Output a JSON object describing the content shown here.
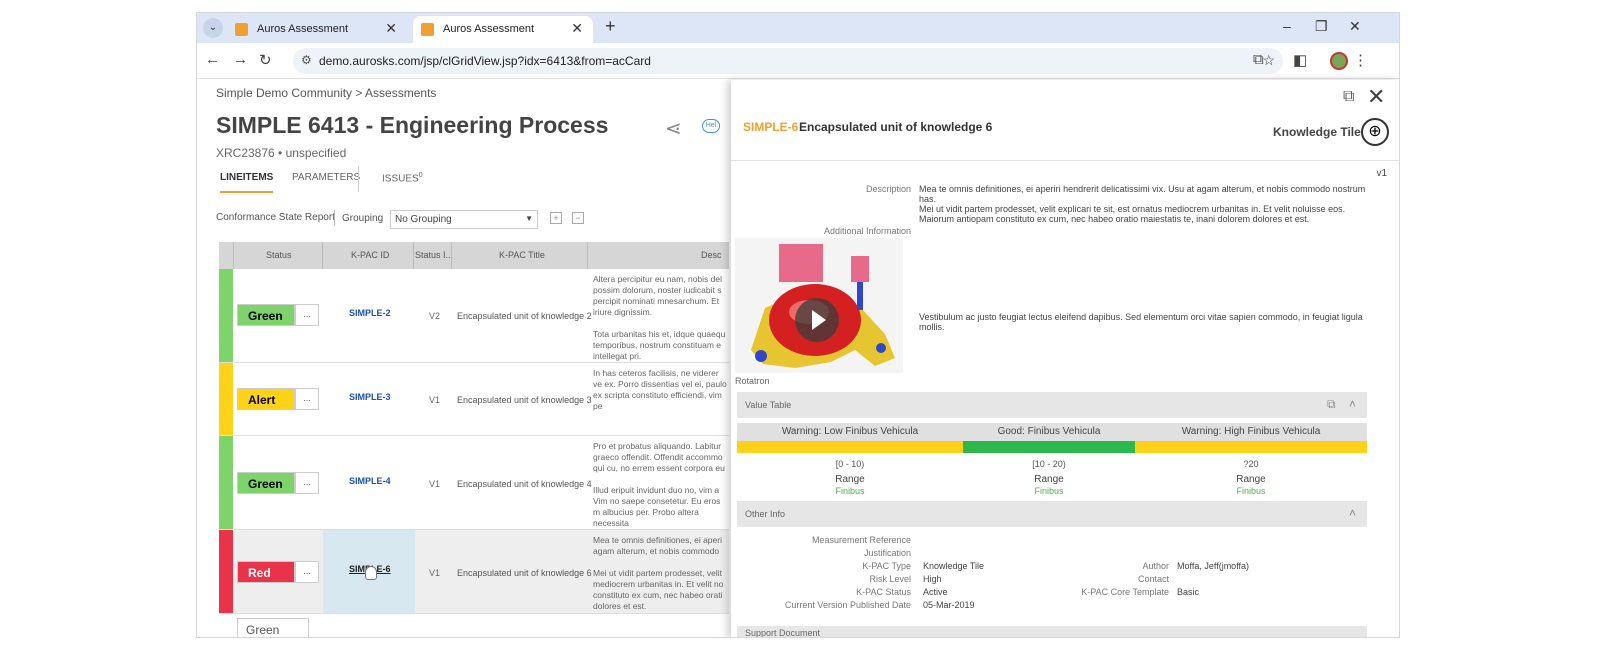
{
  "browser": {
    "tabs": [
      {
        "title": "Auros Assessment",
        "active": false
      },
      {
        "title": "Auros Assessment",
        "active": true
      }
    ],
    "new_tab": "+",
    "url": "demo.aurosks.com/jsp/clGridView.jsp?idx=6413&from=acCard",
    "controls": {
      "minimize": "–",
      "restore": "❐",
      "close": "✕"
    }
  },
  "page": {
    "breadcrumb": "Simple Demo Community > Assessments",
    "title": "SIMPLE 6413 - Engineering Process",
    "subtitle": "XRC23876 • unspecified",
    "help_label": "Hel",
    "tabs": [
      {
        "label": "LINEITEMS",
        "active": true
      },
      {
        "label": "PARAMETERS",
        "active": false
      },
      {
        "label": "ISSUES",
        "active": false,
        "count": "0"
      }
    ],
    "toolbar": {
      "report_label": "Conformance State Report",
      "grouping_label": "Grouping",
      "grouping_value": "No Grouping",
      "expand": "+",
      "collapse": "−"
    },
    "grid": {
      "columns": [
        "Status",
        "K-PAC ID",
        "Status I...",
        "K-PAC Title",
        "Desc"
      ],
      "rows": [
        {
          "status": "Green",
          "status_color": "#7ed36b",
          "bar_color": "#7ed36b",
          "id": "SIMPLE-2",
          "version": "V2",
          "title": "Encapsulated unit of knowledge 2",
          "desc": "Altera percipitur eu nam, nobis del possim dolorum, noster iudicabit s percipit nominati mnesarchum. Et iriure dignissim.\n\nTota urbanitas his et, idque quaequ temporibus, nostrum constituam e intellegat pri."
        },
        {
          "status": "Alert",
          "status_color": "#ffd21a",
          "bar_color": "#ffd21a",
          "id": "SIMPLE-3",
          "version": "V1",
          "title": "Encapsulated unit of knowledge 3",
          "desc": "In has ceteros facilisis, ne viderer ve ex. Porro dissentias vel ei, paulo ex scripta constituto efficiendi, vim pe"
        },
        {
          "status": "Green",
          "status_color": "#7ed36b",
          "bar_color": "#7ed36b",
          "id": "SIMPLE-4",
          "version": "V1",
          "title": "Encapsulated unit of knowledge 4",
          "desc": "Pro et probatus aliquando. Labitur graeco offendit. Offendit accommo qui cu, no errem essent corpora eu\n\nIllud eripuit invidunt duo no, vim a Vim no saepe consetetur. Eu eros m albucius per. Probo altera necessita"
        },
        {
          "status": "Red",
          "status_color": "#e8334a",
          "bar_color": "#e8334a",
          "id": "SIMPLE-6",
          "version": "V1",
          "title": "Encapsulated unit of knowledge 6",
          "desc": "Mea te omnis definitiones, ei aperi agam alterum, et nobis commodo\n\nMei ut vidit partem prodesset, velit mediocrem urbanitas in. Et velit no constituto ex cum, nec habeo orati dolores et est."
        }
      ],
      "partial_status": "Green"
    }
  },
  "panel": {
    "id": "SIMPLE-6",
    "title": "Encapsulated unit of knowledge 6",
    "tile_label": "Knowledge Tile",
    "version": "v1",
    "description_label": "Description",
    "description": "Mea te omnis definitiones, ei aperiri hendrerit delicatissimi vix. Usu at agam alterum, et nobis commodo nostrum has.",
    "additional_label": "Additional Information",
    "additional_p1": "Mei ut vidit partem prodesset, velit explicari te sit, est ornatus mediocrem urbanitas in. Et velit noluisse eos. Maiorum antiopam constituto ex cum, nec habeo oratio maiestatis te, inani dolorem dolores et est.",
    "additional_p2": "Vestibulum ac justo feugiat lectus eleifend dapibus. Sed elementum orci vitae sapien commodo, in feugiat ligula mollis.",
    "media_caption": "Rotatron",
    "value_table": {
      "header": "Value Table",
      "columns": [
        {
          "label": "Warning: Low Finibus Vehicula",
          "color": "#ffd21a",
          "range": "[0 - 10)",
          "kind": "Range",
          "sub": "Finibus"
        },
        {
          "label": "Good: Finibus Vehicula",
          "color": "#2db84d",
          "range": "[10 - 20)",
          "kind": "Range",
          "sub": "Finibus"
        },
        {
          "label": "Warning: High Finibus Vehicula",
          "color": "#ffd21a",
          "range": "?20",
          "kind": "Range",
          "sub": "Finibus"
        }
      ]
    },
    "other_info": {
      "header": "Other Info",
      "fields": [
        {
          "label": "Measurement Reference",
          "value": ""
        },
        {
          "label": "Justification",
          "value": ""
        },
        {
          "label": "K-PAC Type",
          "value": "Knowledge Tile"
        },
        {
          "label": "Risk Level",
          "value": "High"
        },
        {
          "label": "K-PAC Status",
          "value": "Active"
        },
        {
          "label": "Current Version Published Date",
          "value": "05-Mar-2019"
        }
      ],
      "right_fields": [
        {
          "label": "Author",
          "value": "Moffa, Jeff(jmoffa)"
        },
        {
          "label": "Contact",
          "value": ""
        },
        {
          "label": "K-PAC Core Template",
          "value": "Basic"
        }
      ]
    },
    "support_label": "Support Document"
  },
  "icons": {
    "tab_favicon": "auros-logo-icon",
    "share": "share-icon",
    "open_external": "external-link-icon",
    "close": "close-icon",
    "globe": "globe-icon"
  }
}
